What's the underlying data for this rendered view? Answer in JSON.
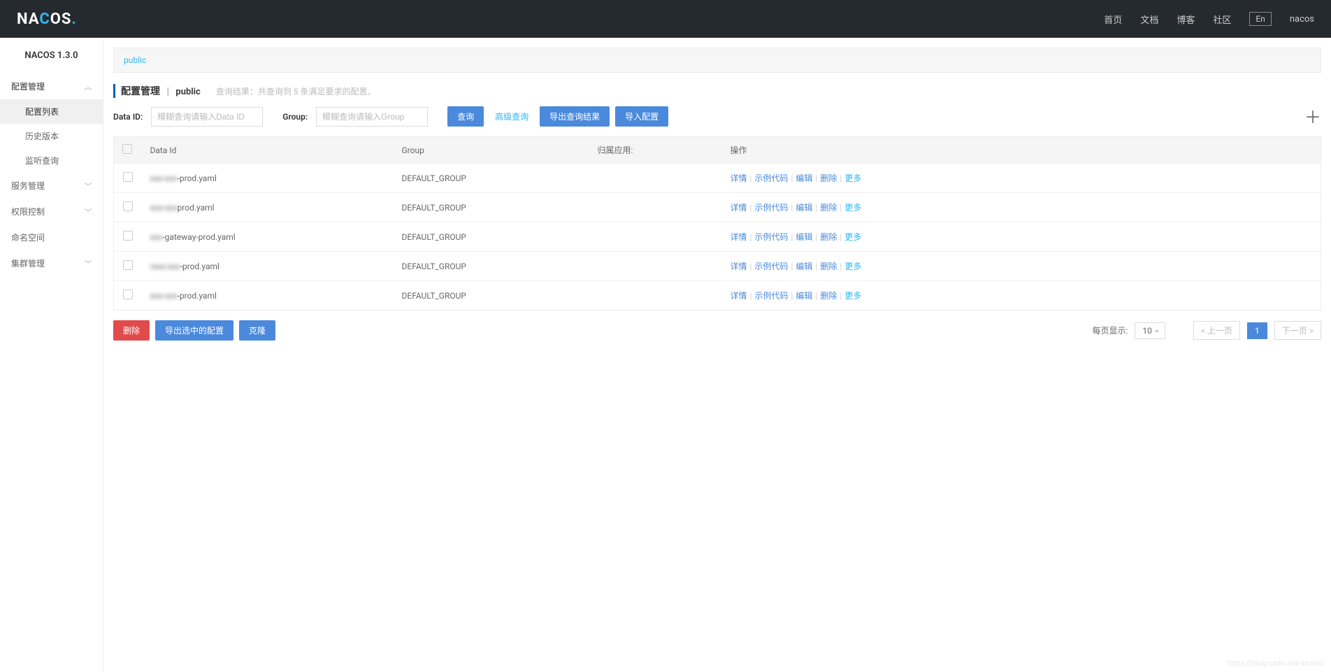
{
  "header": {
    "logo": "NACOS.",
    "links": [
      "首页",
      "文档",
      "博客",
      "社区"
    ],
    "lang": "En",
    "user": "nacos"
  },
  "sidebar": {
    "title": "NACOS 1.3.0",
    "menus": [
      {
        "label": "配置管理",
        "expanded": true,
        "subs": [
          {
            "label": "配置列表",
            "active": true
          },
          {
            "label": "历史版本",
            "active": false
          },
          {
            "label": "监听查询",
            "active": false
          }
        ]
      },
      {
        "label": "服务管理",
        "expanded": false
      },
      {
        "label": "权限控制",
        "expanded": false
      },
      {
        "label": "命名空间",
        "expanded": false
      },
      {
        "label": "集群管理",
        "expanded": false
      }
    ]
  },
  "namespace": {
    "current": "public"
  },
  "page": {
    "title": "配置管理",
    "subtitle": "public",
    "result_prefix": "查询结果：",
    "result_text": "共查询到 5 条满足要求的配置。"
  },
  "filters": {
    "dataid_label": "Data ID:",
    "dataid_placeholder": "模糊查询请输入Data ID",
    "group_label": "Group:",
    "group_placeholder": "模糊查询请输入Group",
    "search_btn": "查询",
    "advanced_btn": "高级查询",
    "export_btn": "导出查询结果",
    "import_btn": "导入配置"
  },
  "table": {
    "headers": [
      "Data Id",
      "Group",
      "归属应用:",
      "操作"
    ],
    "rows": [
      {
        "prefix": "xxx-xxx",
        "suffix": "-prod.yaml",
        "group": "DEFAULT_GROUP",
        "app": ""
      },
      {
        "prefix": "xxx-xxx",
        "suffix": "prod.yaml",
        "group": "DEFAULT_GROUP",
        "app": ""
      },
      {
        "prefix": "xxx",
        "suffix": "-gateway-prod.yaml",
        "group": "DEFAULT_GROUP",
        "app": ""
      },
      {
        "prefix": "rxxx-xxx",
        "suffix": "-prod.yaml",
        "group": "DEFAULT_GROUP",
        "app": ""
      },
      {
        "prefix": "xxx-xxx",
        "suffix": "-prod.yaml",
        "group": "DEFAULT_GROUP",
        "app": ""
      }
    ],
    "actions": {
      "detail": "详情",
      "sample": "示例代码",
      "edit": "编辑",
      "delete": "删除",
      "more": "更多"
    }
  },
  "footer": {
    "delete_btn": "删除",
    "export_selected_btn": "导出选中的配置",
    "clone_btn": "克隆",
    "page_size_label": "每页显示:",
    "page_size": "10",
    "prev": "< 上一页",
    "current": "1",
    "next": "下一页 >"
  },
  "watermark": "https://blog.csdn.net/xxxxxx"
}
